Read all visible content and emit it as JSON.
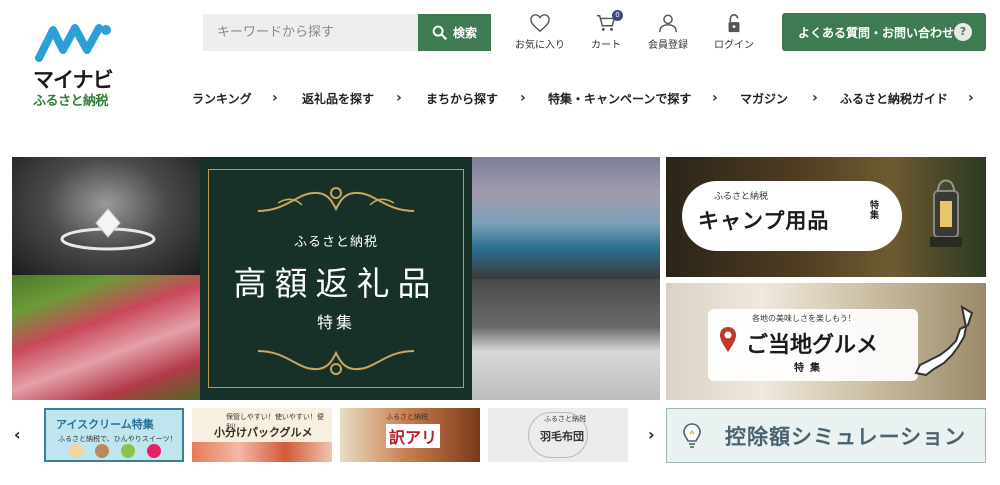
{
  "logo": {
    "brand": "マイナビ",
    "sub": "ふるさと納税"
  },
  "search": {
    "placeholder": "キーワードから探す",
    "button_label": "検索"
  },
  "tools": [
    {
      "label": "お気に入り",
      "icon": "heart-icon"
    },
    {
      "label": "カート",
      "icon": "cart-icon",
      "badge": "0"
    },
    {
      "label": "会員登録",
      "icon": "user-icon"
    },
    {
      "label": "ログイン",
      "icon": "lock-icon"
    }
  ],
  "faq": {
    "label": "よくある質問・お問い合わせ",
    "icon_text": "?"
  },
  "nav": [
    "ランキング",
    "返礼品を探す",
    "まちから探す",
    "特集・キャンペーンで探す",
    "マガジン",
    "ふるさと納税ガイド"
  ],
  "hero": {
    "line1": "ふるさと納税",
    "line2": "高額返礼品",
    "line3": "特集"
  },
  "side_banners": {
    "camp": {
      "small": "ふるさと納税",
      "big": "キャンプ用品",
      "suffix": "特集"
    },
    "gourmet": {
      "small": "各地の美味しさを楽しもう！",
      "big": "ご当地グルメ",
      "sub": "特集"
    }
  },
  "thumbs": [
    {
      "label": "アイスクリーム特集",
      "small": "ふるさと納税で、ひんやりスイーツ！"
    },
    {
      "label": "小分けパックグルメ",
      "small": "保管しやすい！使いやすい！便利！"
    },
    {
      "label": "訳アリ",
      "small": "ふるさと納税"
    },
    {
      "label": "羽毛布団",
      "small": "ふるさと納税"
    }
  ],
  "simulation": {
    "label": "控除額シミュレーション"
  },
  "colors": {
    "brand_green": "#3f7b52",
    "logo_blue": "#2a9fd8",
    "hero_dark": "#173028"
  }
}
